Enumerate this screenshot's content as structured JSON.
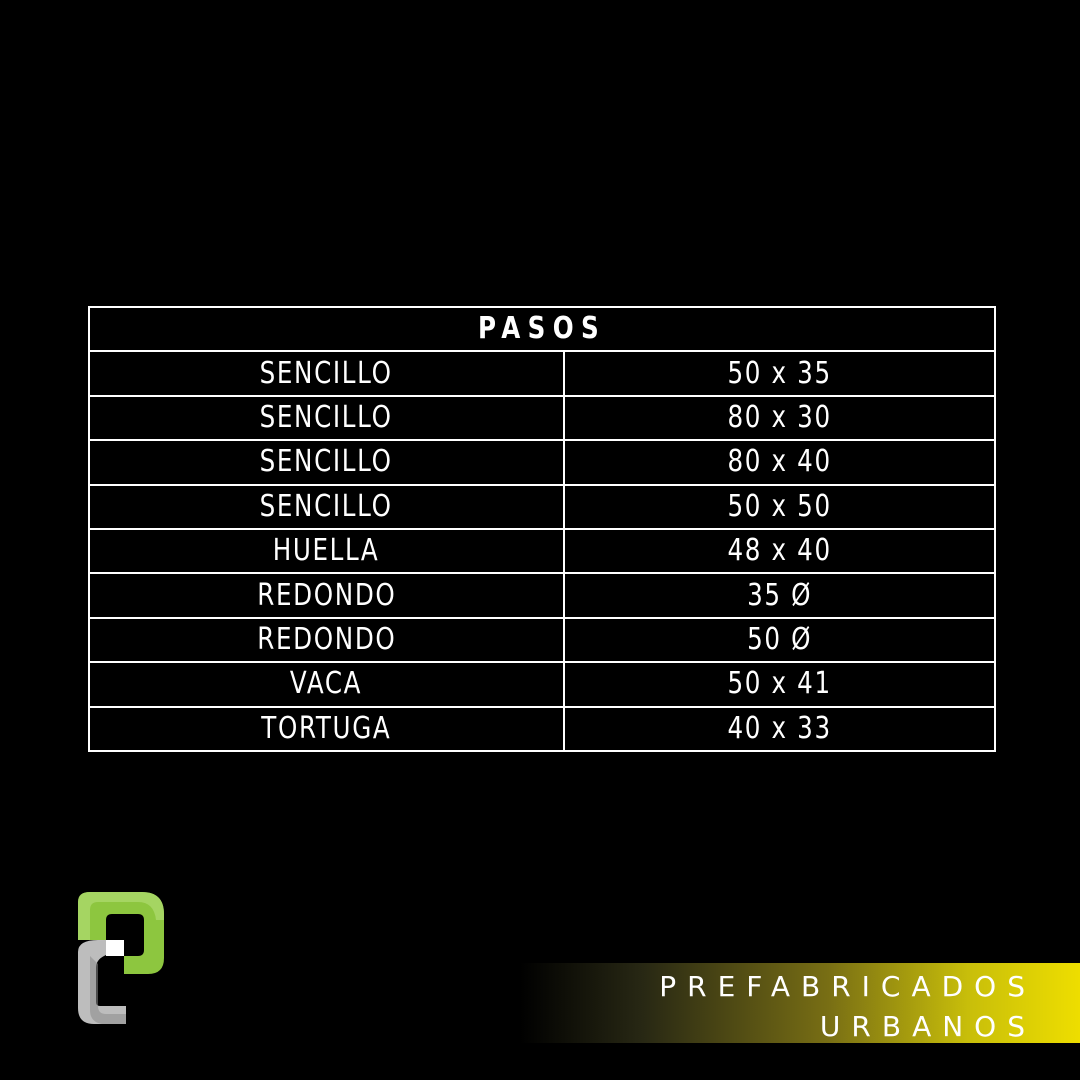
{
  "table": {
    "title": "PASOS",
    "rows": [
      {
        "name": "SENCILLO",
        "size": "50 x 35"
      },
      {
        "name": "SENCILLO",
        "size": "80 x 30"
      },
      {
        "name": "SENCILLO",
        "size": "80 x 40"
      },
      {
        "name": "SENCILLO",
        "size": "50 x 50"
      },
      {
        "name": "HUELLA",
        "size": "48 x 40"
      },
      {
        "name": "REDONDO",
        "size": "35 Ø"
      },
      {
        "name": "REDONDO",
        "size": "50 Ø"
      },
      {
        "name": "VACA",
        "size": "50 x 41"
      },
      {
        "name": "TORTUGA",
        "size": "40 x 33"
      }
    ]
  },
  "brand": {
    "line1": "PREFABRICADOS",
    "line2": "URBANOS",
    "logo_icon": "prefabricados-urbanos-logo",
    "colors": {
      "background": "#000000",
      "logo_green": "#8dc63f",
      "logo_gray": "#bdbdbd",
      "banner_yellow": "#eede00"
    }
  }
}
